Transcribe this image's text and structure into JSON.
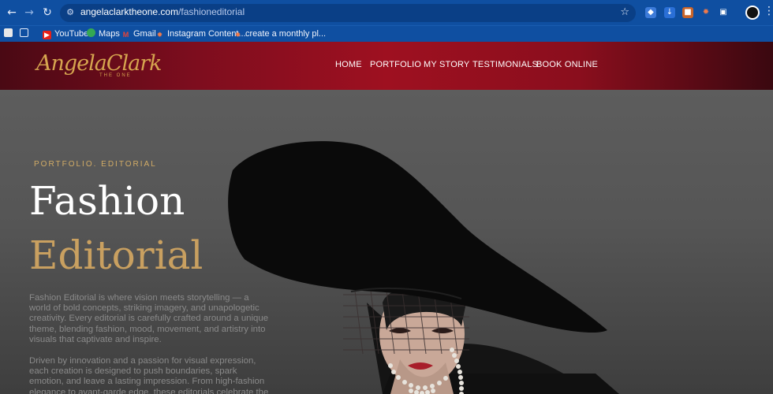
{
  "browser": {
    "url_host": "angelaclarktheone.com",
    "url_path": "/fashioneditorial",
    "bookmarks": [
      "YouTube",
      "Maps",
      "Gmail",
      "Instagram Content...",
      "create a monthly pl..."
    ]
  },
  "site": {
    "logo": "AngelaClark",
    "logo_sub": "THE ONE",
    "nav": [
      "HOME",
      "PORTFOLIO",
      "MY STORY",
      "TESTIMONIALS",
      "BOOK ONLINE"
    ]
  },
  "hero": {
    "eyebrow": "PORTFOLIO. EDITORIAL",
    "title_line1": "Fashion",
    "title_line2": "Editorial",
    "para1": "Fashion Editorial is where vision meets storytelling — a world of bold concepts, striking imagery, and unapologetic creativity. Every editorial is carefully crafted around a unique theme, blending fashion, mood, movement, and artistry into visuals that captivate and inspire.",
    "para2": "Driven by innovation and a passion for visual expression, each creation is designed to push boundaries, spark emotion, and leave a lasting impression. From high-fashion elegance to avant-garde edge, these editorials celebrate the power of style"
  },
  "colors": {
    "chrome": "#0f4fa1",
    "header_red": "#9e1020",
    "gold": "#c9a060",
    "hero_bg": "#5a5a5a"
  }
}
